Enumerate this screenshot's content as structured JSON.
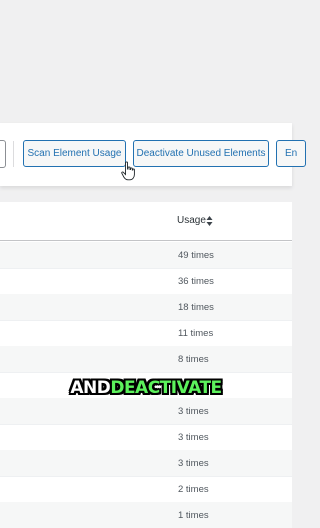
{
  "toolbar": {
    "scan_label": "Scan Element Usage",
    "deactivate_label": "Deactivate Unused Elements",
    "partial_label": "En"
  },
  "table": {
    "usage_header": "Usage",
    "rows": [
      {
        "usage": "49 times"
      },
      {
        "usage": "36 times"
      },
      {
        "usage": "18 times"
      },
      {
        "usage": "11 times"
      },
      {
        "usage": "8 times"
      },
      {
        "usage": ""
      },
      {
        "usage": "3 times"
      },
      {
        "usage": "3 times"
      },
      {
        "usage": "3 times"
      },
      {
        "usage": "2 times"
      },
      {
        "usage": "1 times"
      }
    ]
  },
  "caption": {
    "word1": "AND",
    "word2": "DEACTIVATE"
  },
  "colors": {
    "accent": "#2271b1",
    "caption_highlight": "#5cf25c"
  },
  "icons": [
    "pointer-cursor-icon",
    "sort-icon"
  ]
}
